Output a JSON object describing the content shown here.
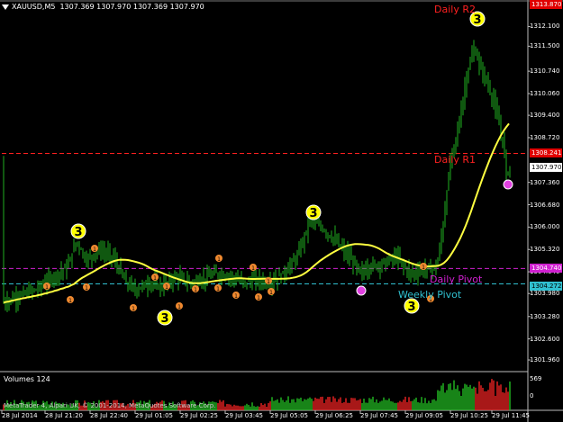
{
  "header": {
    "symbol": "XAUUSD,M5",
    "ohlc": "1307.369 1307.970 1307.369 1307.970"
  },
  "price_scale": [
    "1312.100",
    "1311.500",
    "1310.740",
    "1310.060",
    "1309.400",
    "1308.720",
    "1307.360",
    "1306.680",
    "1306.000",
    "1305.320",
    "1304.640",
    "1303.980",
    "1303.280",
    "1302.600",
    "1301.960"
  ],
  "price_badges": [
    {
      "value": "1313.870",
      "color": "#e00000",
      "text_color": "#ffffff"
    },
    {
      "value": "1308.241",
      "color": "#e00000",
      "text_color": "#ffffff"
    },
    {
      "value": "1307.970",
      "color": "#ffffff",
      "text_color": "#000000"
    },
    {
      "value": "1304.740",
      "color": "#d020d0",
      "text_color": "#ffffff"
    },
    {
      "value": "1304.272",
      "color": "#30c0d0",
      "text_color": "#000000"
    }
  ],
  "levels": [
    {
      "label": "Daily R2",
      "color": "#ff2020"
    },
    {
      "label": "Daily R1",
      "color": "#ff2020"
    },
    {
      "label": "Daily Pivot",
      "color": "#d020d0"
    },
    {
      "label": "Weekly Pivot",
      "color": "#30c0d0"
    }
  ],
  "time_scale": [
    "28 Jul 2014",
    "28 Jul 21:20",
    "28 Jul 22:40",
    "29 Jul 01:05",
    "29 Jul 02:25",
    "29 Jul 03:45",
    "29 Jul 05:05",
    "29 Jul 06:25",
    "29 Jul 07:45",
    "29 Jul 09:05",
    "29 Jul 10:25",
    "29 Jul 11:45"
  ],
  "volume_panel": {
    "label": "Volumes 124",
    "scale_top": "569",
    "scale_bottom": "0"
  },
  "copyright": "MetaTrader 4, Alpari UK, © 2001-2014, MetaQuotes Software Corp.",
  "markers": {
    "wave_label": "3",
    "small_label": "1",
    "wave_color": "#ffff00",
    "small_color": "#f08a30",
    "pivot_marker_color": "#e040e0"
  },
  "colors": {
    "candle": "#20b020",
    "moving_average": "#ffff40",
    "background": "#000000",
    "volume_up": "#20b020",
    "volume_down": "#e02020"
  }
}
